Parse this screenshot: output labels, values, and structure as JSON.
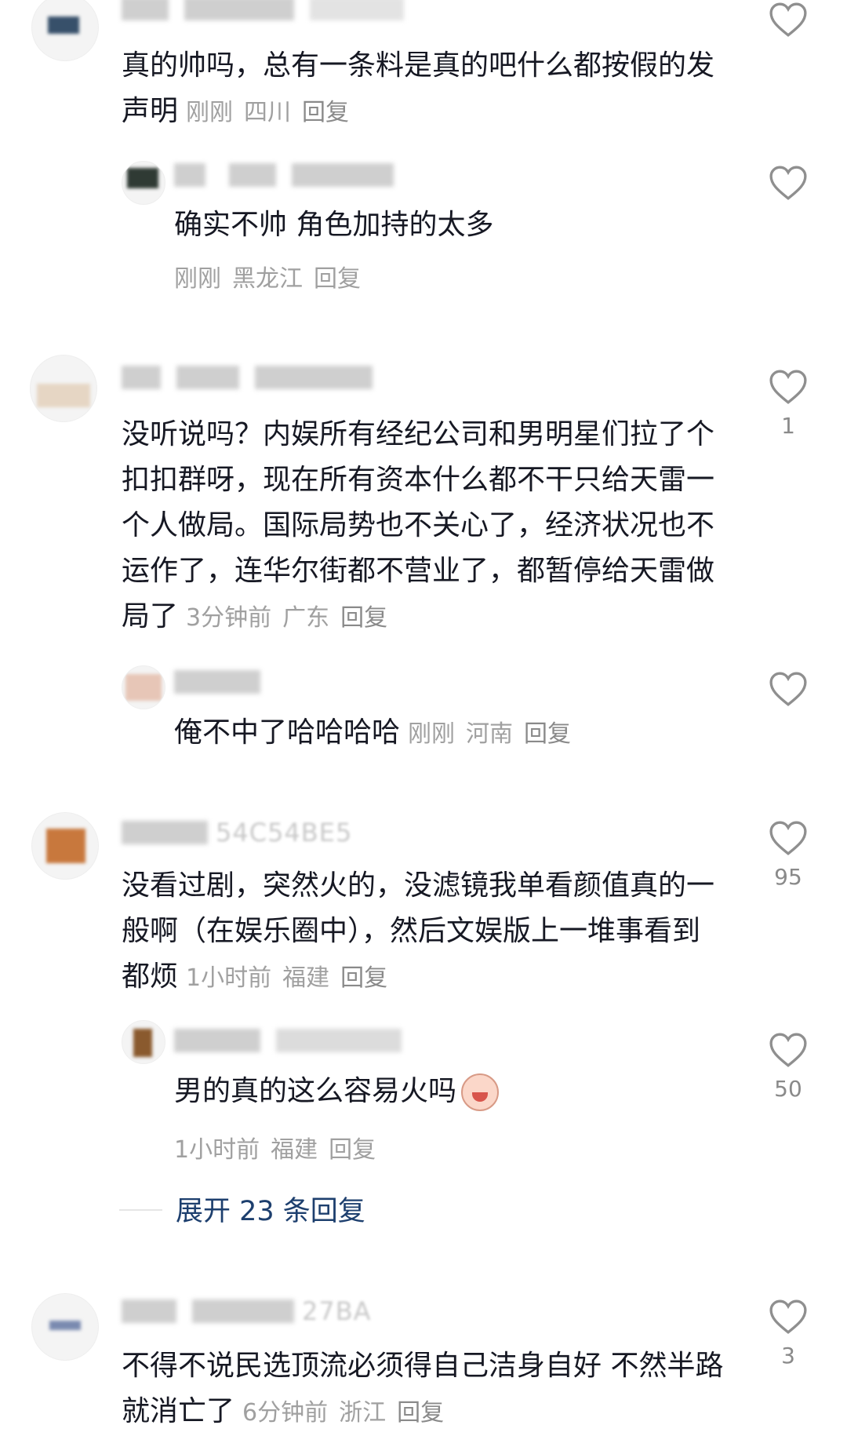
{
  "comments": [
    {
      "text": "真的帅吗，总有一条料是真的吧什么都按假的发声明",
      "time": "刚刚",
      "location": "四川",
      "reply_label": "回复",
      "username_tail": "",
      "likes": ""
    },
    {
      "text": "确实不帅 角色加持的太多",
      "time": "刚刚",
      "location": "黑龙江",
      "reply_label": "回复",
      "username_tail": "",
      "likes": ""
    },
    {
      "text": "没听说吗？内娱所有经纪公司和男明星们拉了个扣扣群呀，现在所有资本什么都不干只给天雷一个人做局。国际局势也不关心了，经济状况也不运作了，连华尔街都不营业了，都暂停给天雷做局了",
      "time": "3分钟前",
      "location": "广东",
      "reply_label": "回复",
      "username_tail": "",
      "likes": "1"
    },
    {
      "text": "俺不中了哈哈哈哈",
      "time": "刚刚",
      "location": "河南",
      "reply_label": "回复",
      "username_tail": "",
      "likes": ""
    },
    {
      "text": "没看过剧，突然火的，没滤镜我单看颜值真的一般啊（在娱乐圈中），然后文娱版上一堆事看到都烦",
      "time": "1小时前",
      "location": "福建",
      "reply_label": "回复",
      "username_tail": "54C54BE5",
      "likes": "95"
    },
    {
      "text": "男的真的这么容易火吗",
      "time": "1小时前",
      "location": "福建",
      "reply_label": "回复",
      "username_tail": "",
      "likes": "50"
    },
    {
      "text": "不得不说民选顶流必须得自己洁身自好 不然半路就消亡了",
      "time": "6分钟前",
      "location": "浙江",
      "reply_label": "回复",
      "username_tail": "27BA",
      "likes": "3"
    }
  ],
  "expand_replies_label": "展开 23 条回复"
}
